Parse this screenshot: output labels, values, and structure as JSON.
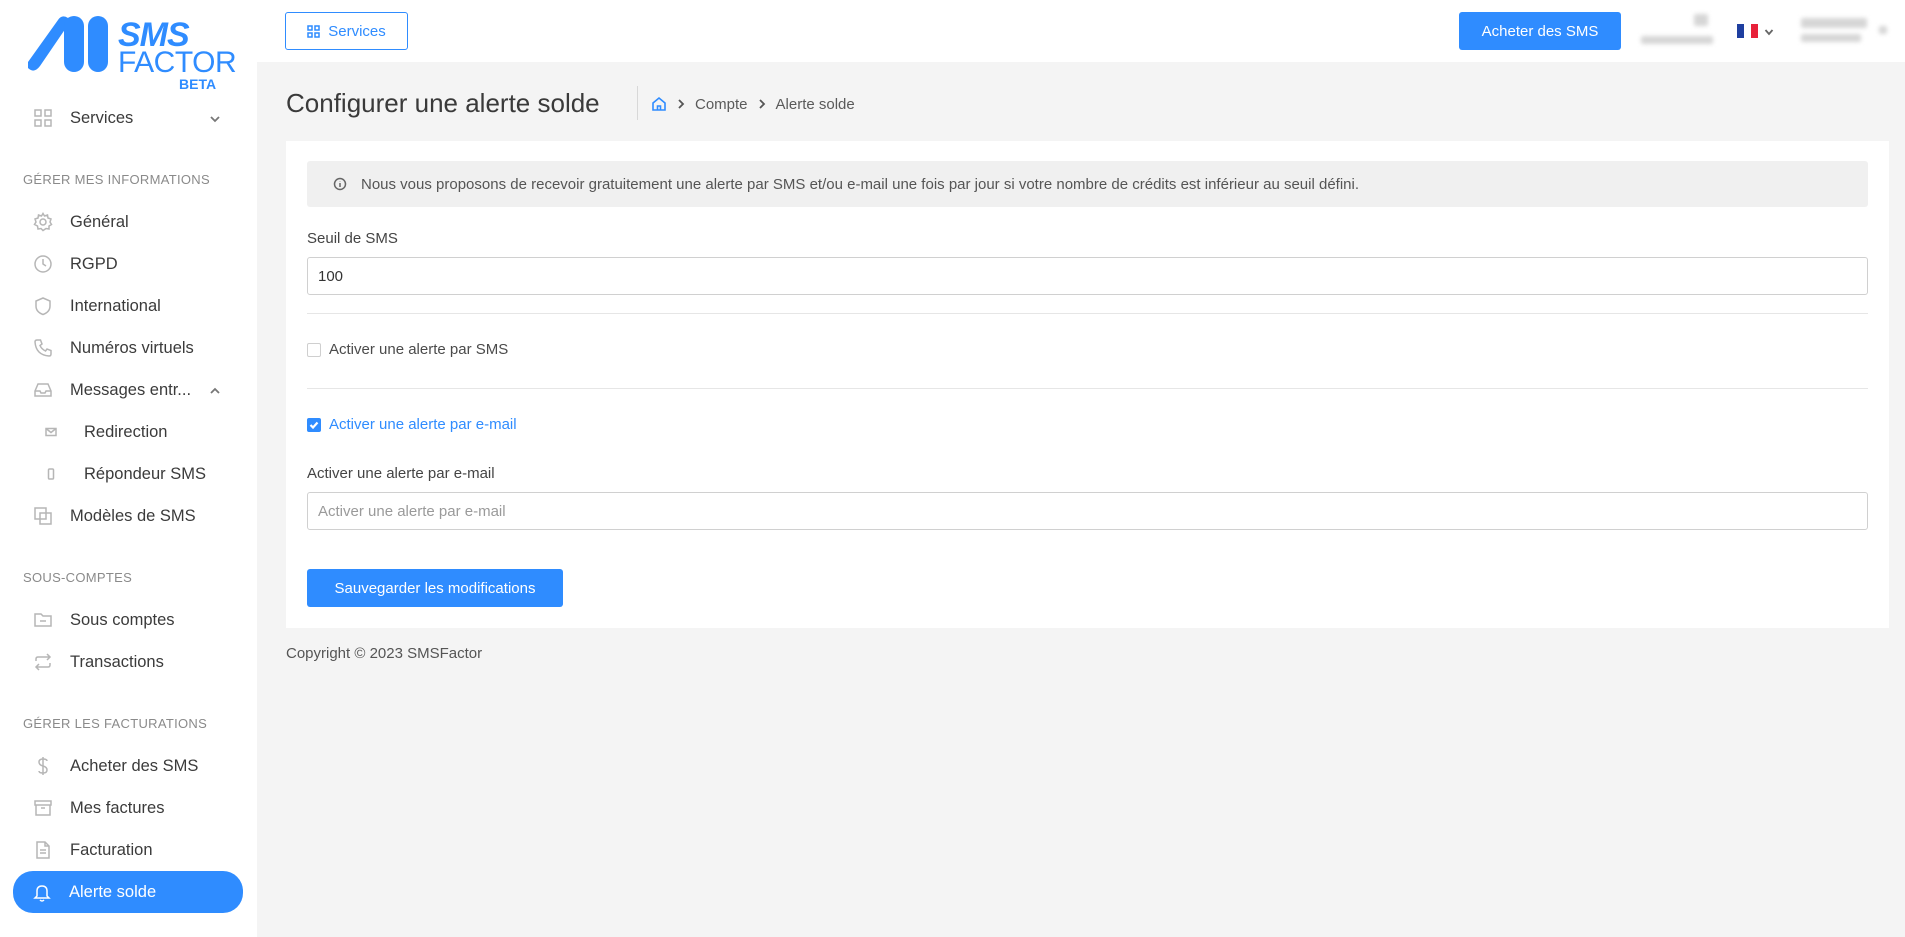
{
  "brand": {
    "line1": "SMS",
    "line2": "FACTOR",
    "line3": "BETA",
    "color": "#2f8cff"
  },
  "header": {
    "services_label": "Services",
    "buy_label": "Acheter des SMS",
    "language_flag": "flag-fr-icon"
  },
  "sidebar": {
    "services": "Services",
    "section_info": "GÉRER MES INFORMATIONS",
    "general": "Général",
    "rgpd": "RGPD",
    "international": "International",
    "virtual_numbers": "Numéros virtuels",
    "incoming": "Messages entr...",
    "redirection": "Redirection",
    "responder": "Répondeur SMS",
    "templates": "Modèles de SMS",
    "section_sub": "SOUS-COMPTES",
    "subaccounts": "Sous comptes",
    "transactions": "Transactions",
    "section_billing": "GÉRER LES FACTURATIONS",
    "buy_sms": "Acheter des SMS",
    "invoices": "Mes factures",
    "billing": "Facturation",
    "balance_alert": "Alerte solde"
  },
  "page": {
    "title": "Configurer une alerte solde",
    "breadcrumb": [
      "Compte",
      "Alerte solde"
    ]
  },
  "form": {
    "info_text": "Nous vous proposons de recevoir gratuitement une alerte par SMS et/ou e-mail une fois par jour si votre nombre de crédits est inférieur au seuil défini.",
    "threshold_label": "Seuil de SMS",
    "threshold_value": "100",
    "sms_alert_label": "Activer une alerte par SMS",
    "sms_alert_checked": false,
    "email_alert_label": "Activer une alerte par e-mail",
    "email_alert_checked": true,
    "email_field_label": "Activer une alerte par e-mail",
    "email_field_placeholder": "Activer une alerte par e-mail",
    "email_field_value": "",
    "save_label": "Sauvegarder les modifications"
  },
  "footer": {
    "copyright": "Copyright © 2023 SMSFactor"
  }
}
